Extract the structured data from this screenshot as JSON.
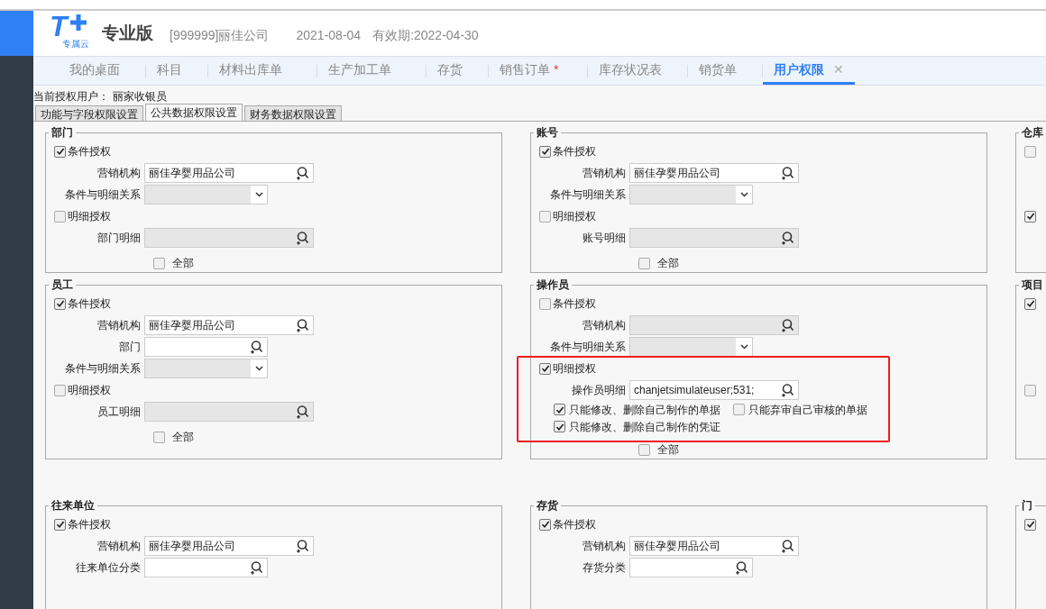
{
  "header": {
    "logo_mark": "T",
    "logo_sub": "专属云",
    "edition": "专业版",
    "company": "[999999]丽佳公司",
    "date": "2021-08-04",
    "validity": "有效期:2022-04-30"
  },
  "tabs": [
    {
      "label": "我的桌面",
      "selected": false,
      "modified": false
    },
    {
      "label": "科目",
      "selected": false,
      "modified": false
    },
    {
      "label": "材料出库单",
      "selected": false,
      "modified": false
    },
    {
      "label": "生产加工单",
      "selected": false,
      "modified": false
    },
    {
      "label": "存货",
      "selected": false,
      "modified": false
    },
    {
      "label": "销售订单",
      "selected": false,
      "modified": true,
      "mark": "*"
    },
    {
      "label": "库存状况表",
      "selected": false,
      "modified": false
    },
    {
      "label": "销货单",
      "selected": false,
      "modified": false
    },
    {
      "label": "用户权限",
      "selected": true,
      "modified": false,
      "close": "✕"
    }
  ],
  "current_user": {
    "label": "当前授权用户：",
    "value": "丽家收银员"
  },
  "sub_tabs": [
    {
      "label": "功能与字段权限设置",
      "selected": false
    },
    {
      "label": "公共数据权限设置",
      "selected": true
    },
    {
      "label": "财务数据权限设置",
      "selected": false
    }
  ],
  "columns": [
    {
      "panels": [
        {
          "title": "部门",
          "rows": [
            {
              "kind": "checkbox",
              "label": "条件授权",
              "checked": true
            },
            {
              "kind": "lookup",
              "label": "营销机构",
              "value": "丽佳孕婴用品公司",
              "disabled": false
            },
            {
              "kind": "select",
              "label": "条件与明细关系",
              "disabled": true
            },
            {
              "kind": "checkbox",
              "label": "明细授权",
              "checked": false
            },
            {
              "kind": "lookup",
              "label": "部门明细",
              "disabled": true
            },
            {
              "kind": "all",
              "label": "全部",
              "checked": false
            }
          ]
        },
        {
          "title": "员工",
          "rows": [
            {
              "kind": "checkbox",
              "label": "条件授权",
              "checked": true
            },
            {
              "kind": "lookup",
              "label": "营销机构",
              "value": "丽佳孕婴用品公司",
              "disabled": false
            },
            {
              "kind": "short-lookup",
              "label": "部门",
              "disabled": false
            },
            {
              "kind": "select",
              "label": "条件与明细关系",
              "disabled": true
            },
            {
              "kind": "checkbox",
              "label": "明细授权",
              "checked": false
            },
            {
              "kind": "lookup",
              "label": "员工明细",
              "disabled": true
            },
            {
              "kind": "all",
              "label": "全部",
              "checked": false
            }
          ]
        },
        {
          "title": "往来单位",
          "rows": [
            {
              "kind": "checkbox",
              "label": "条件授权",
              "checked": true
            },
            {
              "kind": "lookup",
              "label": "营销机构",
              "value": "丽佳孕婴用品公司",
              "disabled": false
            },
            {
              "kind": "short-lookup",
              "label": "往来单位分类",
              "disabled": false
            }
          ]
        }
      ]
    },
    {
      "panels": [
        {
          "title": "账号",
          "rows": [
            {
              "kind": "checkbox",
              "label": "条件授权",
              "checked": true
            },
            {
              "kind": "lookup",
              "label": "营销机构",
              "value": "丽佳孕婴用品公司",
              "disabled": false
            },
            {
              "kind": "select",
              "label": "条件与明细关系",
              "disabled": true
            },
            {
              "kind": "checkbox",
              "label": "明细授权",
              "checked": false
            },
            {
              "kind": "lookup",
              "label": "账号明细",
              "disabled": true
            },
            {
              "kind": "all",
              "label": "全部",
              "checked": false
            }
          ]
        },
        {
          "title": "操作员",
          "highlighted": true,
          "rows": [
            {
              "kind": "checkbox",
              "label": "条件授权",
              "checked": false
            },
            {
              "kind": "lookup",
              "label": "营销机构",
              "disabled": true
            },
            {
              "kind": "select",
              "label": "条件与明细关系",
              "disabled": true
            },
            {
              "kind": "checkbox",
              "label": "明细授权",
              "checked": true
            },
            {
              "kind": "lookup",
              "label": "操作员明细",
              "value": "chanjetsimulateuser;531;",
              "disabled": false
            },
            {
              "kind": "options",
              "items": [
                {
                  "label": "只能修改、删除自己制作的单据",
                  "checked": true
                },
                {
                  "label": "只能弃审自己审核的单据",
                  "checked": false
                }
              ]
            },
            {
              "kind": "options",
              "items": [
                {
                  "label": "只能修改、删除自己制作的凭证",
                  "checked": true
                }
              ]
            },
            {
              "kind": "all",
              "label": "全部",
              "checked": false
            }
          ]
        },
        {
          "title": "存货",
          "rows": [
            {
              "kind": "checkbox",
              "label": "条件授权",
              "checked": true
            },
            {
              "kind": "lookup",
              "label": "营销机构",
              "value": "丽佳孕婴用品公司",
              "disabled": false
            },
            {
              "kind": "short-lookup",
              "label": "存货分类",
              "disabled": false
            }
          ]
        }
      ]
    },
    {
      "panels": [
        {
          "title": "仓库",
          "rows": [
            {
              "kind": "checkbox",
              "checked": false
            },
            {
              "kind": "spacer"
            },
            {
              "kind": "spacer"
            },
            {
              "kind": "checkbox",
              "checked": true
            }
          ]
        },
        {
          "title": "项目",
          "rows": [
            {
              "kind": "checkbox",
              "checked": true
            },
            {
              "kind": "spacer"
            },
            {
              "kind": "spacer"
            },
            {
              "kind": "spacer"
            },
            {
              "kind": "checkbox",
              "checked": false
            }
          ]
        },
        {
          "title": "门",
          "rows": [
            {
              "kind": "checkbox",
              "checked": true
            }
          ]
        }
      ]
    }
  ]
}
